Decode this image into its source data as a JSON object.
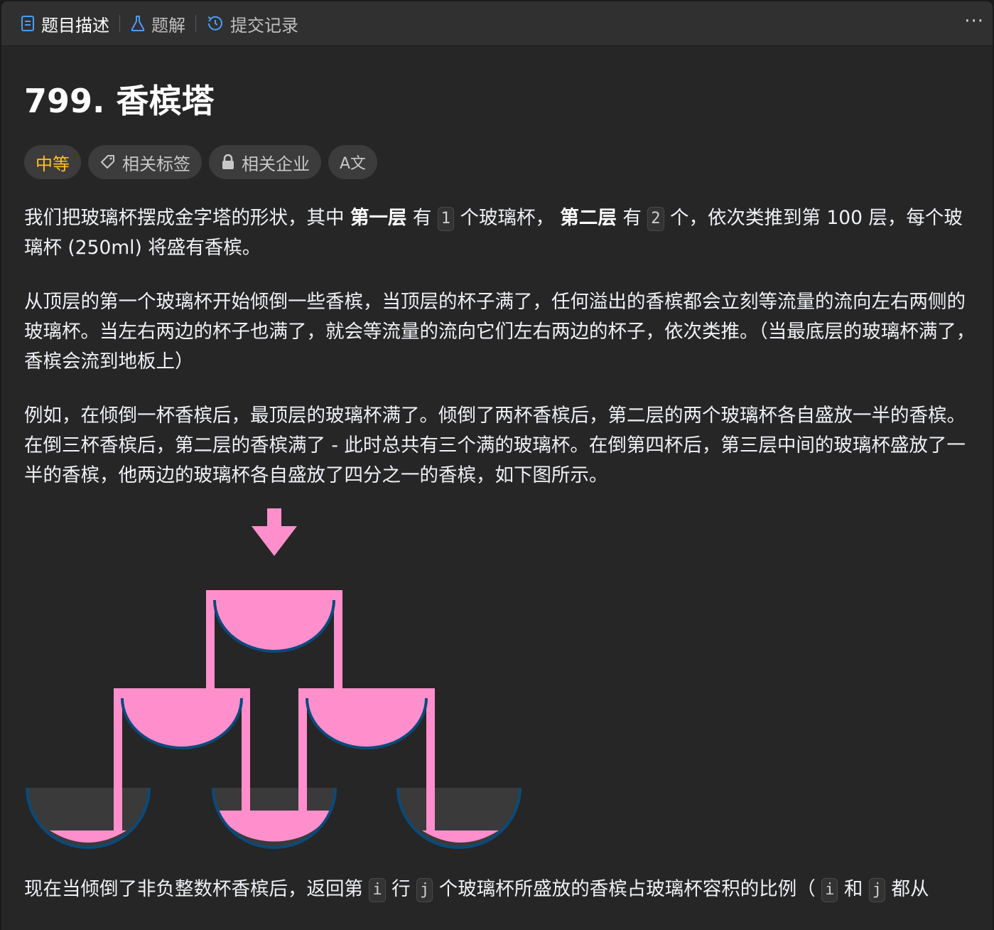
{
  "tabs": [
    {
      "label": "题目描述",
      "icon": "description-icon"
    },
    {
      "label": "题解",
      "icon": "flask-icon"
    },
    {
      "label": "提交记录",
      "icon": "history-icon"
    }
  ],
  "more_label": "···",
  "problem": {
    "title": "799. 香槟塔",
    "difficulty": "中等",
    "tags_label": "相关标签",
    "companies_label": "相关企业",
    "translate_label": "A文"
  },
  "desc": {
    "p1": {
      "s1": "我们把玻璃杯摆成金字塔的形状，其中 ",
      "b1": "第一层",
      "s2": " 有 ",
      "c1": "1",
      "s3": " 个玻璃杯， ",
      "b2": "第二层",
      "s4": " 有 ",
      "c2": "2",
      "s5": " 个，依次类推到第 100 层，每个玻璃杯 (250ml) 将盛有香槟。"
    },
    "p2": "从顶层的第一个玻璃杯开始倾倒一些香槟，当顶层的杯子满了，任何溢出的香槟都会立刻等流量的流向左右两侧的玻璃杯。当左右两边的杯子也满了，就会等流量的流向它们左右两边的杯子，依次类推。（当最底层的玻璃杯满了，香槟会流到地板上）",
    "p3": "例如，在倾倒一杯香槟后，最顶层的玻璃杯满了。倾倒了两杯香槟后，第二层的两个玻璃杯各自盛放一半的香槟。在倒三杯香槟后，第二层的香槟满了 - 此时总共有三个满的玻璃杯。在倒第四杯后，第三层中间的玻璃杯盛放了一半的香槟，他两边的玻璃杯各自盛放了四分之一的香槟，如下图所示。",
    "p4": {
      "s1": "现在当倾倒了非负整数杯香槟后，返回第 ",
      "c1": "i",
      "s2": " 行 ",
      "c2": "j",
      "s3": " 个玻璃杯所盛放的香槟占玻璃杯容积的比例（ ",
      "c3": "i",
      "s4": " 和 ",
      "c4": "j",
      "s5": " 都从"
    }
  },
  "colors": {
    "champagne": "#ff8fcc",
    "glass_rim": "#0a4a7a",
    "empty_glass": "#3a3a3a",
    "difficulty": "#ffc01e"
  }
}
